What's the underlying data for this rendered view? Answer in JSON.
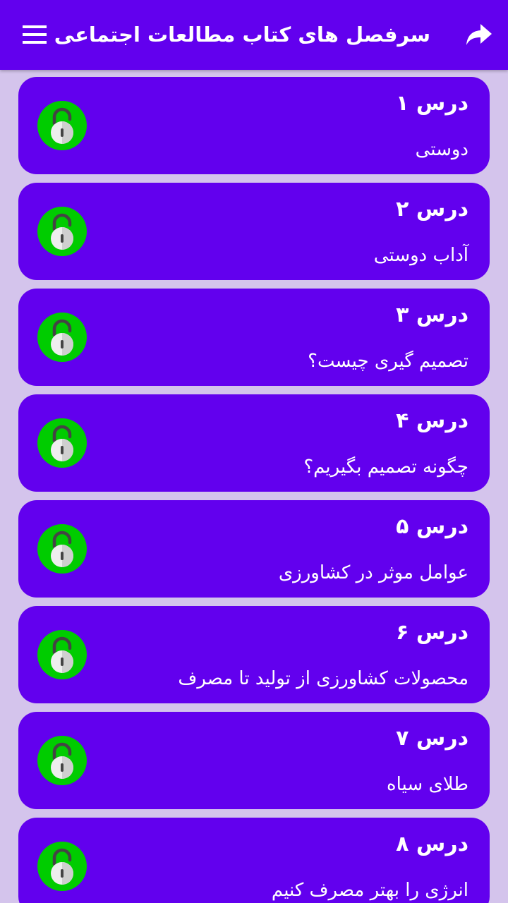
{
  "app_bar": {
    "title": "سرفصل های کتاب مطالعات اجتماعی",
    "menu_icon": "hamburger-menu-icon",
    "share_icon": "share-forward-icon",
    "background_color": "#6200ee"
  },
  "colors": {
    "page_background": "#d4c4ec",
    "card_background": "#6200ee",
    "lock_green": "#00cc00",
    "lock_body": "#eeeeee"
  },
  "lessons": [
    {
      "title": "درس ۱",
      "subtitle": "دوستی",
      "icon": "unlocked-padlock-icon"
    },
    {
      "title": "درس ۲",
      "subtitle": "آداب دوستی",
      "icon": "unlocked-padlock-icon"
    },
    {
      "title": "درس ۳",
      "subtitle": "تصمیم گیری چیست؟",
      "icon": "unlocked-padlock-icon"
    },
    {
      "title": "درس ۴",
      "subtitle": "چگونه تصمیم بگیریم؟",
      "icon": "unlocked-padlock-icon"
    },
    {
      "title": "درس ۵",
      "subtitle": "عوامل موثر در کشاورزی",
      "icon": "unlocked-padlock-icon"
    },
    {
      "title": "درس ۶",
      "subtitle": "محصولات کشاورزی از تولید تا مصرف",
      "icon": "unlocked-padlock-icon"
    },
    {
      "title": "درس ۷",
      "subtitle": "طلای سیاه",
      "icon": "unlocked-padlock-icon"
    },
    {
      "title": "درس ۸",
      "subtitle": "انرژی را بهتر مصرف کنیم",
      "icon": "unlocked-padlock-icon"
    }
  ]
}
